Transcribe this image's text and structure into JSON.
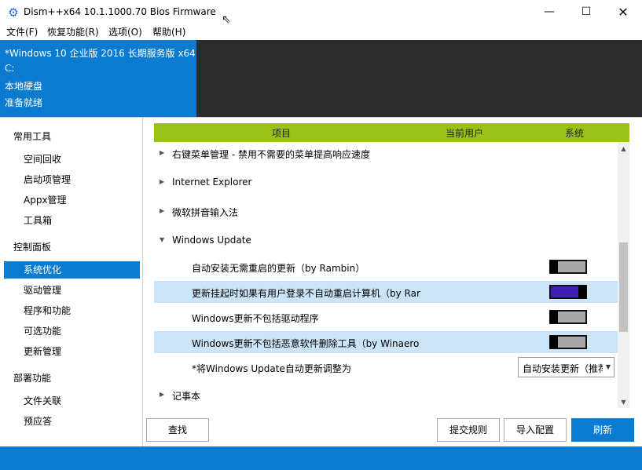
{
  "window": {
    "title": "Dism++x64 10.1.1000.70 Bios Firmware",
    "icon": "gear-cluster-icon",
    "controls": {
      "minimize": "—",
      "maximize": "☐",
      "close": "✕"
    }
  },
  "menu": [
    "文件(F)",
    "恢复功能(R)",
    "选项(O)",
    "帮助(H)"
  ],
  "info": {
    "system": "*Windows 10 企业版 2016 长期服务版 x64",
    "drive": "C:",
    "disk": "本地硬盘",
    "status": "准备就绪"
  },
  "sidebar": {
    "groups": [
      {
        "title": "常用工具",
        "items": [
          "空间回收",
          "启动项管理",
          "Appx管理",
          "工具箱"
        ]
      },
      {
        "title": "控制面板",
        "items": [
          "系统优化",
          "驱动管理",
          "程序和功能",
          "可选功能",
          "更新管理"
        ]
      },
      {
        "title": "部署功能",
        "items": [
          "文件关联",
          "预应答"
        ]
      }
    ],
    "active": "系统优化"
  },
  "table": {
    "headers": [
      "项目",
      "当前用户",
      "系统"
    ],
    "rows": [
      {
        "label": "右键菜单管理 - 禁用不需要的菜单提高响应速度"
      },
      {
        "label": "Internet Explorer"
      },
      {
        "label": "微软拼音输入法"
      },
      {
        "label": "Windows Update"
      },
      {
        "label": "自动安装无需重启的更新（by Rambin）",
        "state": "off"
      },
      {
        "label": "更新挂起时如果有用户登录不自动重启计算机（by Rar",
        "state": "on"
      },
      {
        "label": "Windows更新不包括驱动程序",
        "state": "off"
      },
      {
        "label": "Windows更新不包括恶意软件删除工具（by Winaero",
        "state": "off"
      },
      {
        "label": "*将Windows Update自动更新调整为",
        "value": "自动安装更新（推荐）"
      },
      {
        "label": "记事本"
      }
    ]
  },
  "buttons": {
    "find": "查找",
    "submit_rules": "提交规则",
    "import_config": "导入配置",
    "refresh": "刷新"
  },
  "colors": {
    "accent": "#0a7bd0",
    "header_green": "#9cc21a",
    "row_highlight": "#cce4f7",
    "toggle_on": "#3f1fb3"
  }
}
